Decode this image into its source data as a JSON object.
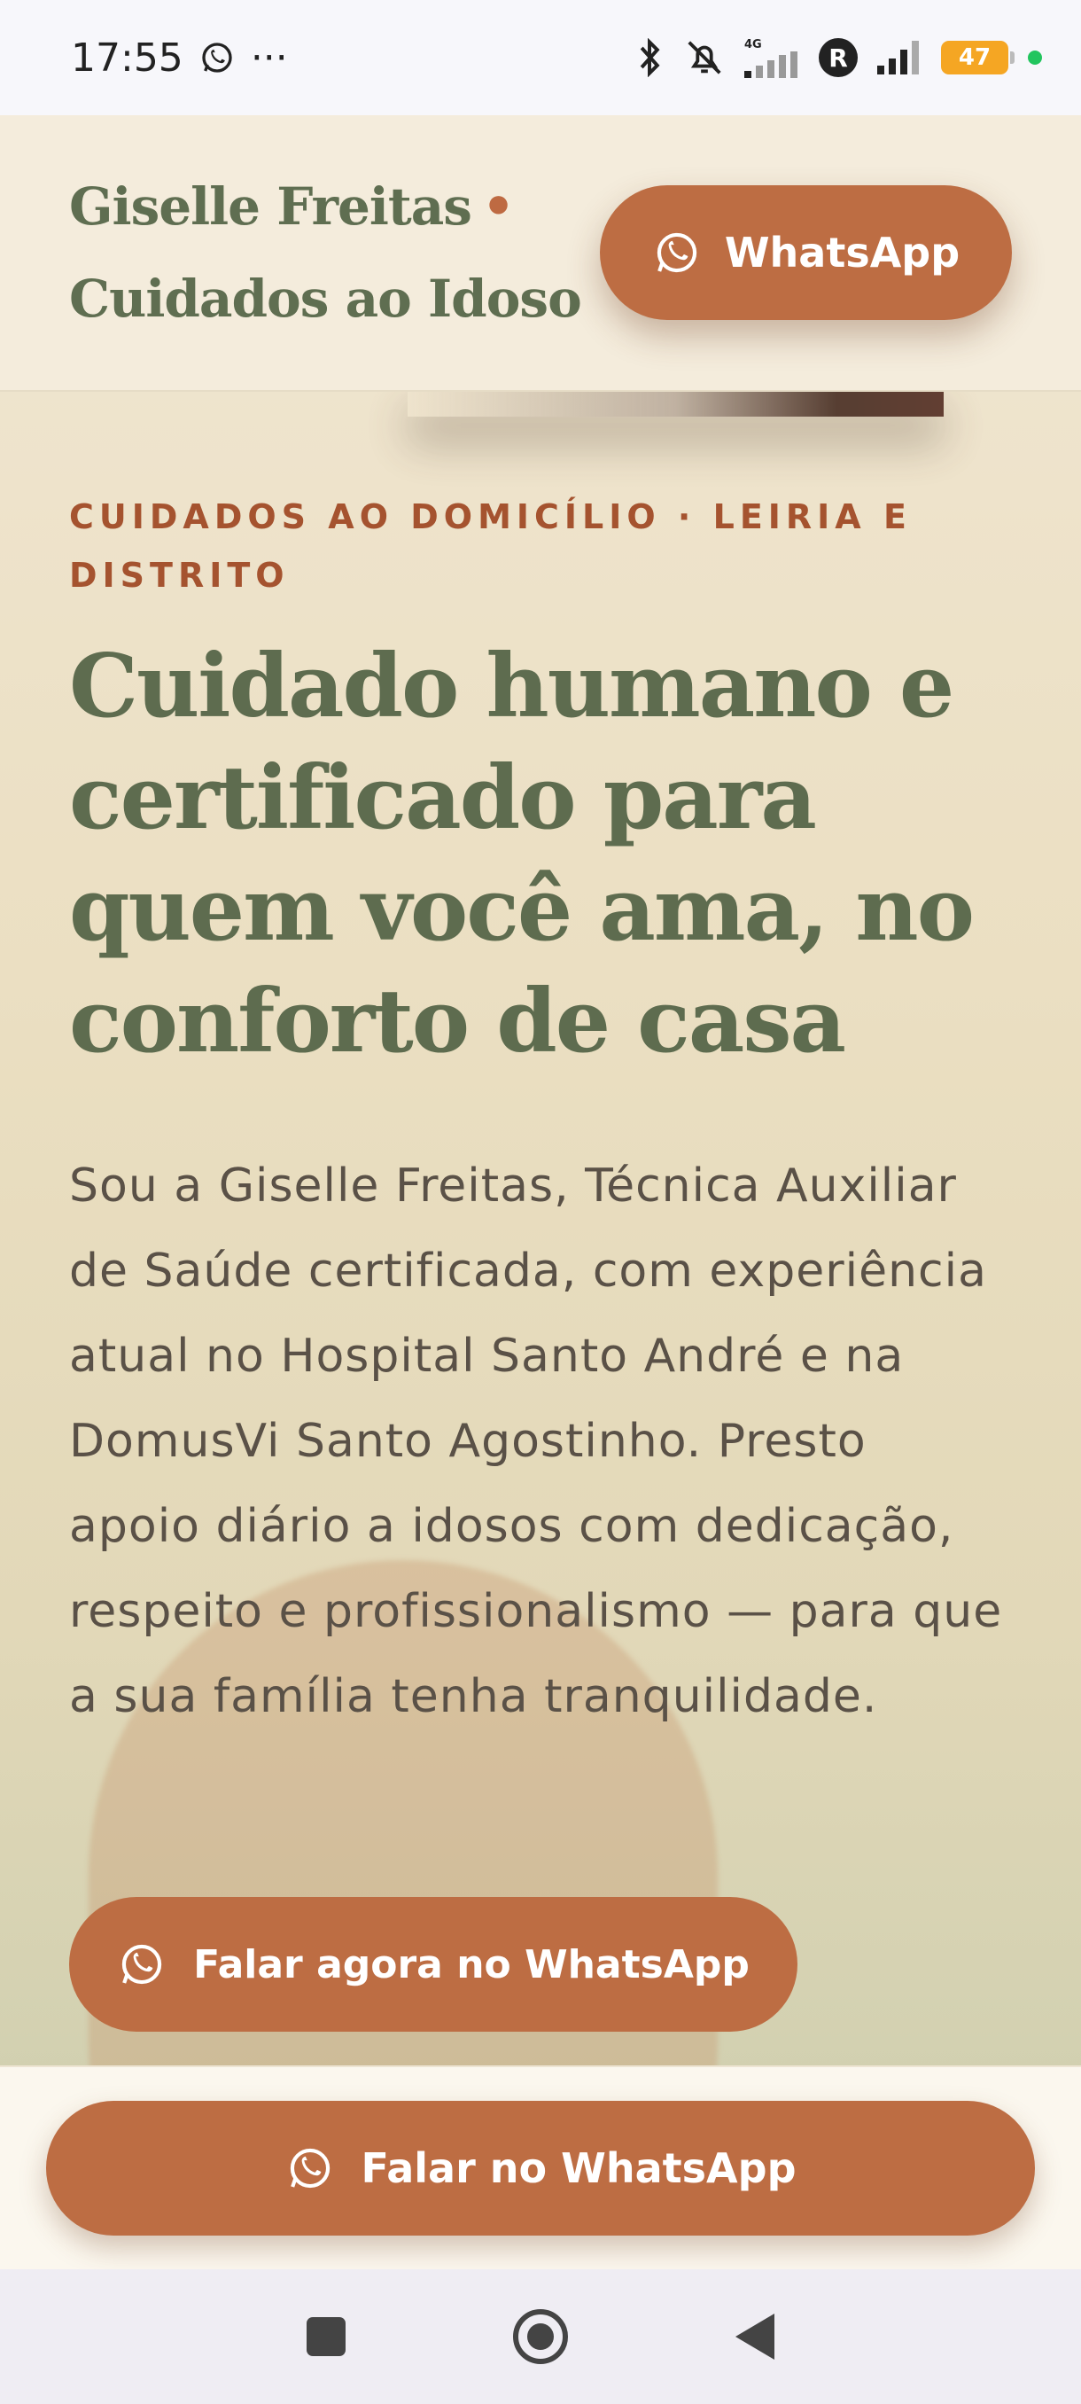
{
  "status_bar": {
    "time": "17:55",
    "more": "···",
    "network_label": "4G",
    "profile_letter": "R",
    "battery": "47"
  },
  "header": {
    "brand_line1": "Giselle Freitas",
    "brand_dot": "•",
    "brand_line2": "Cuidados ao Idoso",
    "whatsapp_label": "WhatsApp"
  },
  "hero": {
    "eyebrow": "CUIDADOS AO DOMICÍLIO · LEIRIA E DISTRITO",
    "title": "Cuidado humano e certificado para quem você ama, no conforto de casa",
    "description": "Sou a Giselle Freitas, Técnica Auxiliar de Saúde certificada, com experiência atual no Hospital Santo André e na DomusVi Santo Agostinho. Presto apoio diário a idosos com dedicação, respeito e profissionalismo — para que a sua família tenha tranquilidade.",
    "cta_label": "Falar agora no WhatsApp"
  },
  "sticky": {
    "cta_label": "Falar no WhatsApp"
  },
  "colors": {
    "accent": "#bd6d43",
    "heading": "#5e6c4f",
    "eyebrow": "#a5532f"
  },
  "icons": [
    "whatsapp-icon",
    "bluetooth-icon",
    "bell-off-icon",
    "signal-icon",
    "battery-icon",
    "recents-icon",
    "home-icon",
    "back-icon"
  ]
}
